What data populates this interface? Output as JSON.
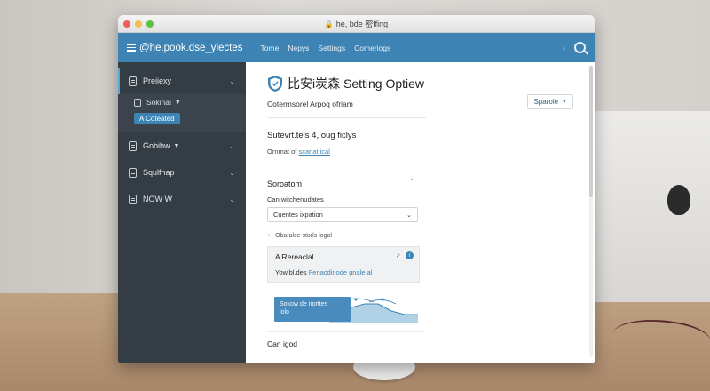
{
  "window": {
    "title": "he, bde 密ffing"
  },
  "appbar": {
    "title": "@he.pook.dse_ylectes",
    "nav": [
      "Tome",
      "Nepys",
      "Settings",
      "Comeriogs"
    ]
  },
  "sidebar": {
    "items": [
      {
        "label": "Preiiexy",
        "active": true
      },
      {
        "label": "Gobibw"
      },
      {
        "label": "Squlfhap"
      },
      {
        "label": "NOW W"
      }
    ],
    "sub_item": "Sokinal",
    "badge": "A Coteated"
  },
  "main": {
    "title": "比安i炭森 Setting Optiew",
    "subtitle": "Cotermsorel Arpoq ofriam",
    "dropdown": "Sparole",
    "section_heading": "Sutevrt.tels 4, oug ficlys",
    "meta_prefix": "Ornmat of",
    "meta_link": "scanat.ical",
    "panel": {
      "heading": "Soroatom",
      "field_label": "Can witchenudates",
      "select_value": "Cuentes ixpation",
      "plus_label": "Obaralce storls logol"
    },
    "card": {
      "heading": "A Rereaclal",
      "sub_prefix": "Yow.bl.des",
      "sub_link": "Fenacdinode gnale al"
    },
    "chart_tooltip": [
      "Sokow de norttes",
      "lolo"
    ],
    "footer": "Can igod"
  },
  "colors": {
    "accent": "#3d84b4",
    "sidebar": "#343c44",
    "chart_fill": "#9ec6e0"
  }
}
